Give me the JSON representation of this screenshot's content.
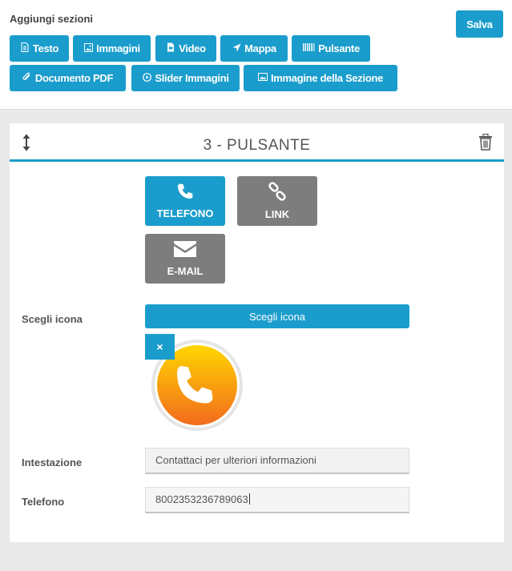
{
  "toolbar": {
    "title": "Aggiungi sezioni",
    "save_label": "Salva",
    "sections": [
      {
        "label": "Testo",
        "icon": "file-text-icon"
      },
      {
        "label": "Immagini",
        "icon": "image-icon"
      },
      {
        "label": "Video",
        "icon": "video-file-icon"
      },
      {
        "label": "Mappa",
        "icon": "location-arrow-icon"
      },
      {
        "label": "Pulsante",
        "icon": "barcode-icon"
      },
      {
        "label": "Documento PDF",
        "icon": "paperclip-icon"
      },
      {
        "label": "Slider Immagini",
        "icon": "play-circle-icon"
      },
      {
        "label": "Immagine della Sezione",
        "icon": "picture-icon"
      }
    ]
  },
  "panel": {
    "title": "3 - PULSANTE",
    "button_types": [
      {
        "label": "TELEFONO",
        "icon": "phone-icon",
        "active": true
      },
      {
        "label": "LINK",
        "icon": "link-icon",
        "active": false
      },
      {
        "label": "E-MAIL",
        "icon": "envelope-icon",
        "active": false
      }
    ],
    "icon_label": "Scegli icona",
    "icon_button_label": "Scegli icona",
    "remove_label": "×",
    "heading_label": "Intestazione",
    "heading_value": "Contattaci per ulteriori informazioni",
    "phone_label": "Telefono",
    "phone_value": "8002353236789063"
  },
  "colors": {
    "accent": "#1a9dcc",
    "inactive": "#7d7d7d",
    "icon_gradient_top": "#ffd600",
    "icon_gradient_bottom": "#f26b1d"
  }
}
